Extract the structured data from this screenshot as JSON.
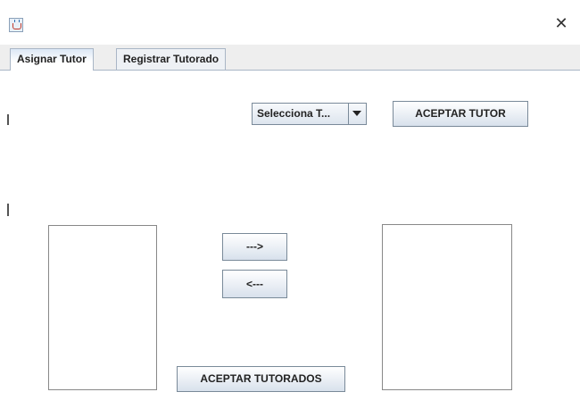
{
  "window": {
    "close_glyph": "✕"
  },
  "tabs": [
    {
      "label": "Asignar Tutor",
      "active": true
    },
    {
      "label": "Registrar Tutorado",
      "active": false
    }
  ],
  "tutor_select": {
    "value": "Selecciona T..."
  },
  "buttons": {
    "accept_tutor": "ACEPTAR TUTOR",
    "move_right": "--->",
    "move_left": "<---",
    "accept_tutees": "ACEPTAR TUTORADOS"
  },
  "lists": {
    "available": [],
    "assigned": []
  }
}
